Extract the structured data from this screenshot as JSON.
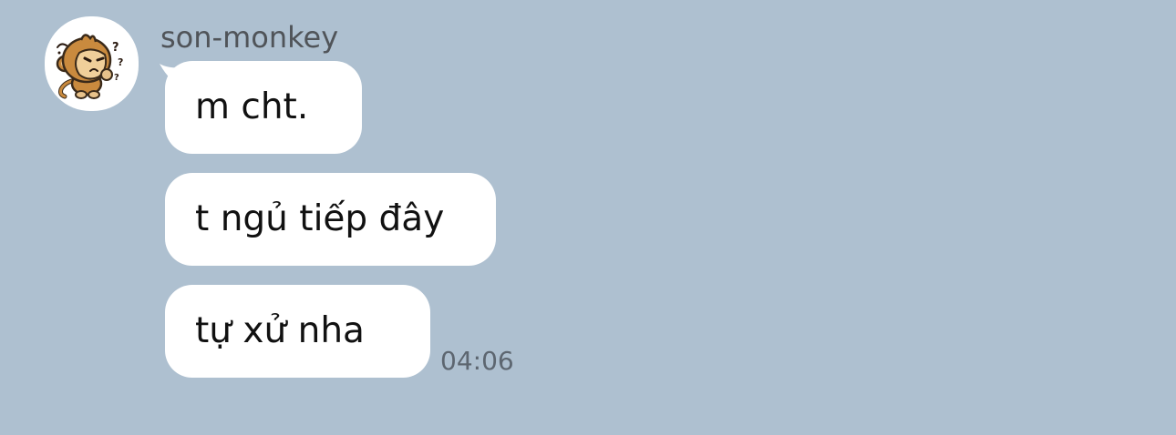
{
  "chat": {
    "background_color": "#aec0d0",
    "sender": {
      "name": "son-monkey",
      "avatar_icon": "confused-monkey-sticker-icon"
    },
    "messages": [
      {
        "text": "m cht."
      },
      {
        "text": "t ngủ tiếp đây"
      },
      {
        "text": "tự xử nha"
      }
    ],
    "last_message_time": "04:06"
  }
}
